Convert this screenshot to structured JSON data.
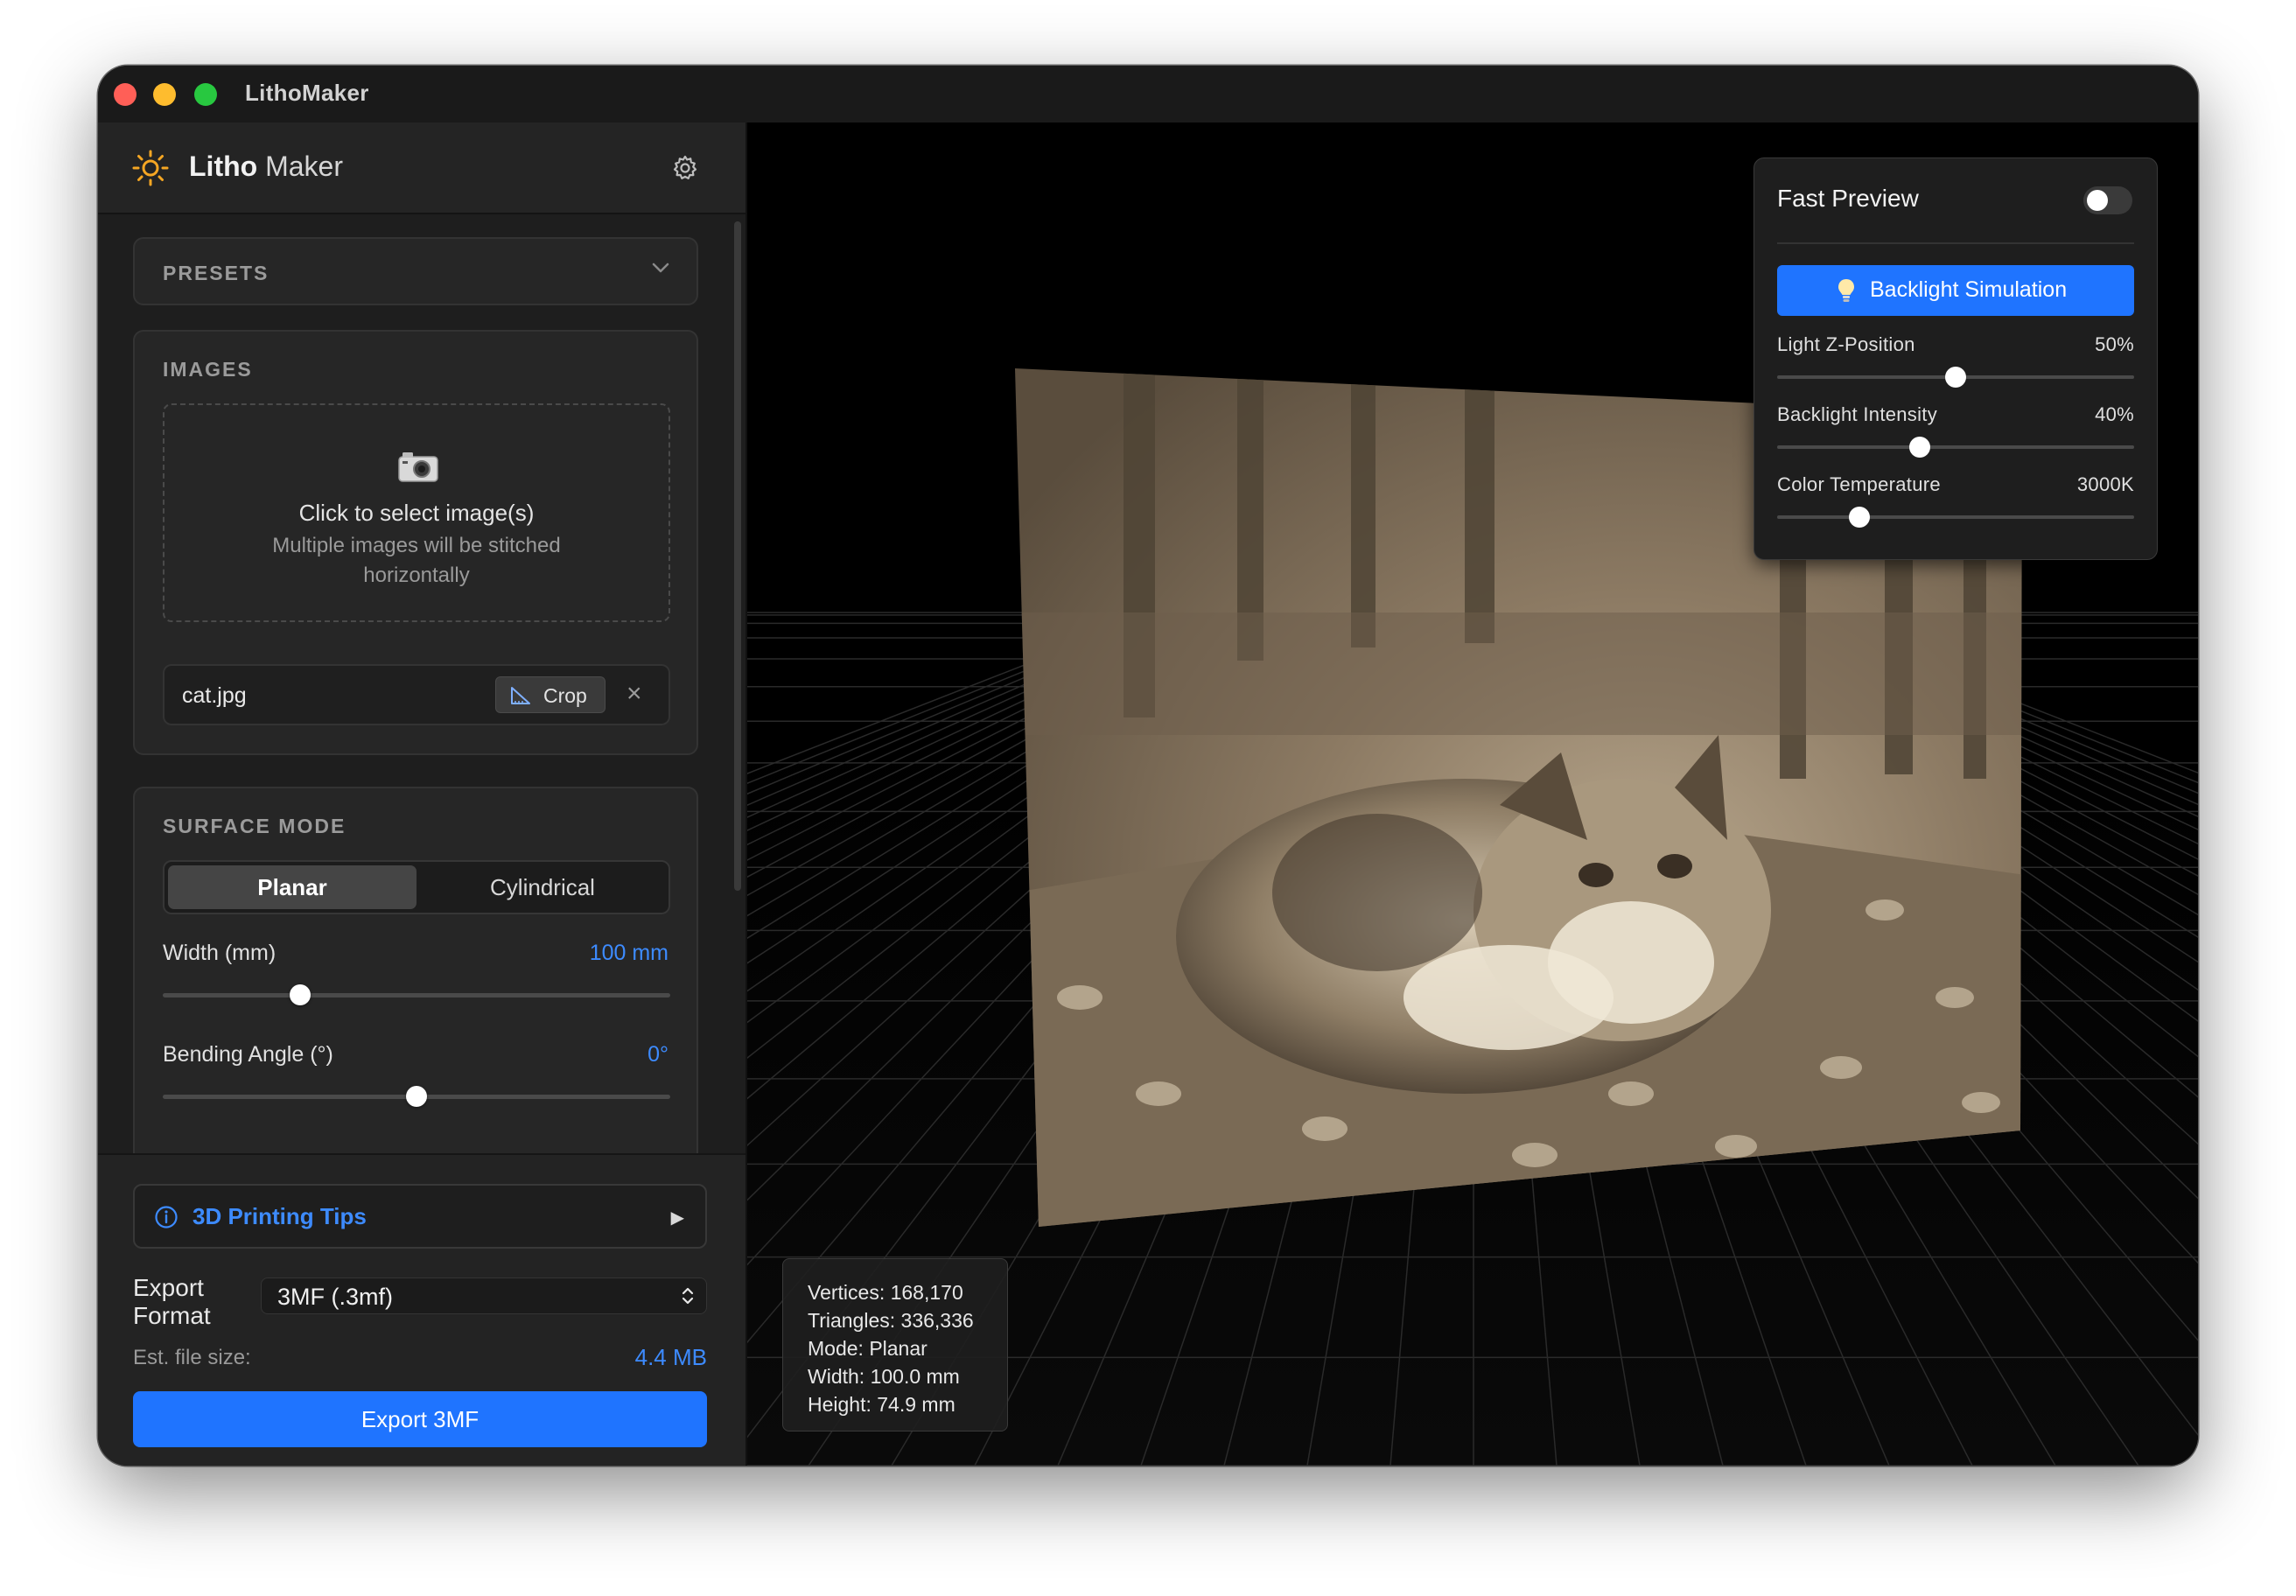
{
  "window": {
    "title": "LithoMaker"
  },
  "sidebar": {
    "brand": {
      "part1": "Litho",
      "part2": "Maker"
    },
    "presets": {
      "title": "PRESETS"
    },
    "images": {
      "title": "IMAGES",
      "drop_main": "Click to select image(s)",
      "drop_sub": "Multiple images will be stitched horizontally",
      "file": {
        "name": "cat.jpg",
        "crop_label": "Crop",
        "remove_glyph": "×"
      }
    },
    "surface": {
      "title": "SURFACE MODE",
      "modes": [
        "Planar",
        "Cylindrical"
      ],
      "selected_mode": "Planar",
      "width": {
        "label": "Width (mm)",
        "value_text": "100 mm",
        "fraction": 0.27
      },
      "bending": {
        "label": "Bending Angle (°)",
        "value_text": "0°",
        "fraction": 0.5
      }
    },
    "tips": {
      "label": "3D Printing Tips",
      "arrow": "▶"
    },
    "export": {
      "format_label": "Export Format",
      "format_value": "3MF (.3mf)",
      "est_label": "Est. file size:",
      "est_value": "4.4 MB",
      "button_label": "Export 3MF"
    }
  },
  "viewport": {
    "stats": [
      "Vertices: 168,170",
      "Triangles: 336,336",
      "Mode: Planar",
      "Width: 100.0 mm",
      "Height: 74.9 mm"
    ],
    "panel": {
      "fast_preview_label": "Fast Preview",
      "fast_preview_on": false,
      "backlight_button": "Backlight Simulation",
      "sliders": [
        {
          "label": "Light Z-Position",
          "value_text": "50%",
          "fraction": 0.5
        },
        {
          "label": "Backlight Intensity",
          "value_text": "40%",
          "fraction": 0.4
        },
        {
          "label": "Color Temperature",
          "value_text": "3000K",
          "fraction": 0.23
        }
      ]
    }
  },
  "colors": {
    "accent": "#1f74ff",
    "link": "#3d8bff",
    "litho_tint": "#a08f77",
    "traffic_red": "#ff5f57",
    "traffic_yellow": "#febc2e",
    "traffic_green": "#28c840"
  },
  "icons": {
    "brand": "sun-icon",
    "settings": "gear-icon",
    "presets_toggle": "chevron-down-icon",
    "drop": "camera-icon",
    "crop": "crop-ruler-icon",
    "tips": "info-icon",
    "select": "chevron-updown-icon",
    "backlight": "lightbulb-icon"
  }
}
